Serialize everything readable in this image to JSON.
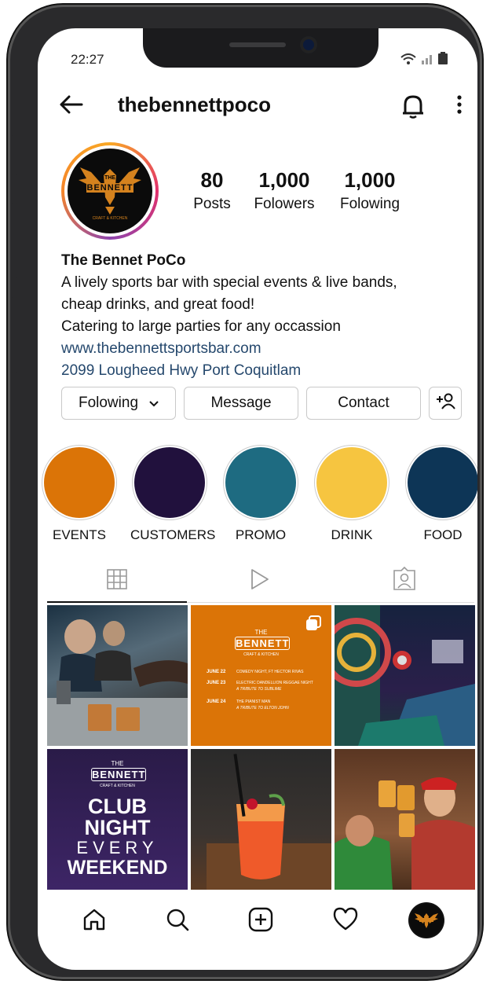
{
  "status": {
    "time": "22:27"
  },
  "header": {
    "username": "thebennettpoco"
  },
  "profile": {
    "avatar_text_top": "THE",
    "avatar_text_main": "BENNETT",
    "avatar_text_sub": "CRAFT & KITCHEN",
    "posts_count": "80",
    "posts_label": "Posts",
    "followers_count": "1,000",
    "followers_label": "Folowers",
    "following_count": "1,000",
    "following_label": "Folowing",
    "name": "The Bennet PoCo",
    "bio_line1": "A lively sports bar with special events & live bands,",
    "bio_line2": "cheap drinks, and great food!",
    "bio_line3": "Catering to large parties for any occassion",
    "website": "www.thebennettsportsbar.com",
    "address": "2099 Lougheed Hwy Port Coquitlam"
  },
  "actions": {
    "following": "Folowing",
    "message": "Message",
    "contact": "Contact"
  },
  "highlights": [
    {
      "label": "EVENTS",
      "color": "#db7407"
    },
    {
      "label": "CUSTOMERS",
      "color": "#21113d"
    },
    {
      "label": "PROMO",
      "color": "#1e6b81"
    },
    {
      "label": "DRINK",
      "color": "#f6c540"
    },
    {
      "label": "FOOD",
      "color": "#0d3556"
    }
  ],
  "posts": {
    "events_post": {
      "logo_top": "THE",
      "logo_main": "BENNETT",
      "logo_sub": "CRAFT & KITCHEN",
      "rows": [
        {
          "date": "JUNE 22",
          "text": "COMEDY NIGHT, FT HECTOR RIVAS",
          "sub": ""
        },
        {
          "date": "JUNE 23",
          "text": "ELECTRIC DANDELLION REGGAE NIGHT",
          "sub": "A TRIBUTE TO SUBLIME"
        },
        {
          "date": "JUNE 24",
          "text": "THE PIANIST MAN",
          "sub": "A TRIBUTE TO ELTON JOHN"
        }
      ]
    },
    "club_post": {
      "logo_top": "THE",
      "logo_main": "BENNETT",
      "logo_sub": "CRAFT & KITCHEN",
      "line1": "CLUB",
      "line2": "NIGHT",
      "line3": "EVERY",
      "line4": "WEEKEND"
    }
  },
  "colors": {
    "accent": "#db7407",
    "link": "#25486d"
  }
}
